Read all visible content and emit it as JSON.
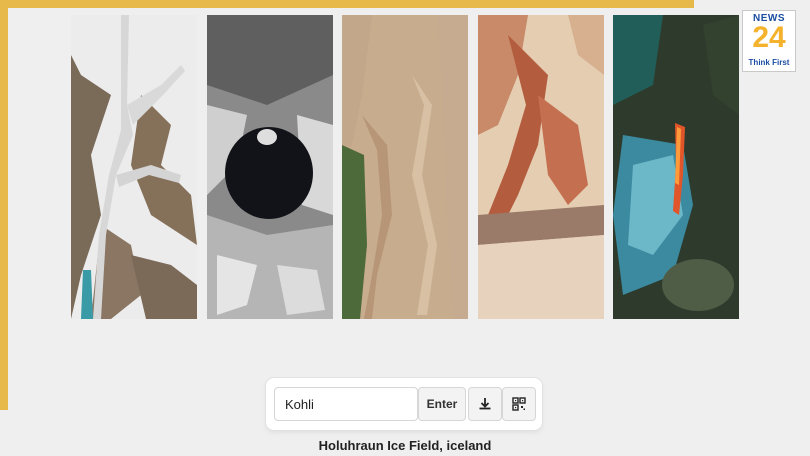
{
  "branding": {
    "logo_top": "NEWS",
    "logo_number": "24",
    "logo_tagline": "Think First"
  },
  "gallery": {
    "panels": [
      {
        "id": "glacier"
      },
      {
        "id": "crater-lake"
      },
      {
        "id": "desert-fault"
      },
      {
        "id": "red-canyon"
      },
      {
        "id": "lava-field"
      }
    ]
  },
  "search": {
    "input_value": "Kohli",
    "enter_label": "Enter",
    "download_icon": "download-icon",
    "qr_icon": "qr-code-icon"
  },
  "caption": "Holuhraun Ice Field, iceland",
  "colors": {
    "accent": "#e7b84a",
    "logo_blue": "#1b4ea1",
    "logo_gold": "#f5b22d"
  }
}
